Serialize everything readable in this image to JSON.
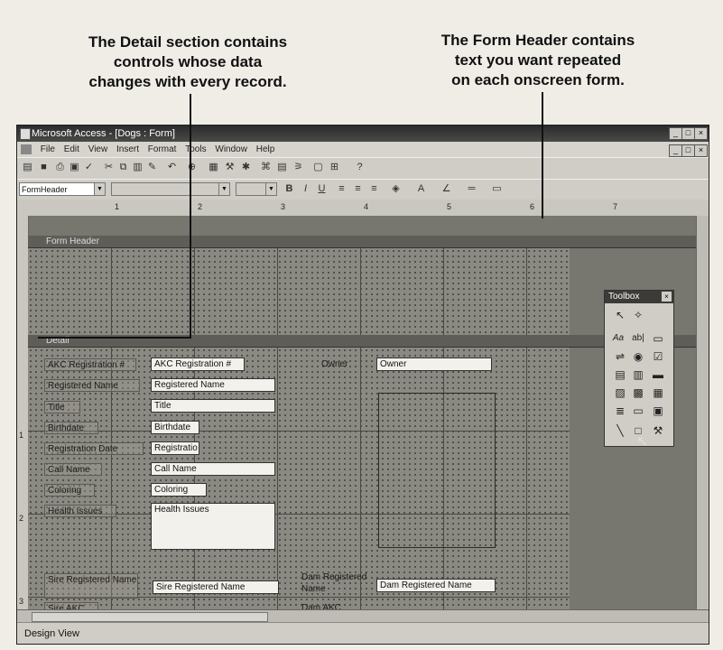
{
  "callouts": {
    "detail": [
      "The Detail section contains",
      "controls whose data",
      "changes with every record."
    ],
    "header": [
      "The Form Header contains",
      "text you want repeated",
      "on each onscreen form."
    ]
  },
  "window": {
    "title": "Microsoft Access - [Dogs : Form]",
    "controls": [
      "_",
      "□",
      "×"
    ]
  },
  "menu": [
    "File",
    "Edit",
    "View",
    "Insert",
    "Format",
    "Tools",
    "Window",
    "Help"
  ],
  "format_toolbar": {
    "object_combo": "FormHeader",
    "font_combo": "",
    "size_combo": "",
    "bold": "B",
    "italic": "I",
    "underline": "U"
  },
  "ruler": [
    "1",
    "2",
    "3",
    "4",
    "5",
    "6",
    "7"
  ],
  "vruler": [
    "1",
    "2",
    "3"
  ],
  "sections": {
    "form_header": "Form Header",
    "detail": "Detail"
  },
  "fields": [
    {
      "label": "AKC Registration #",
      "value": "AKC Registration #"
    },
    {
      "label": "Registered Name",
      "value": "Registered Name"
    },
    {
      "label": "Title",
      "value": "Title"
    },
    {
      "label": "Birthdate",
      "value": "Birthdate"
    },
    {
      "label": "Registration Date",
      "value": "Registratio"
    },
    {
      "label": "Call Name",
      "value": "Call Name"
    },
    {
      "label": "Coloring",
      "value": "Coloring"
    },
    {
      "label": "Health Issues",
      "value": "Health Issues"
    },
    {
      "label": "Sire Registered Name",
      "value": "Sire Registered Name"
    },
    {
      "label": "Sire AKC",
      "value": ""
    }
  ],
  "right_fields": [
    {
      "label": "Owner",
      "value": "Owner"
    },
    {
      "label": "Dam Registered Name",
      "value": "Dam Registered Name"
    },
    {
      "label": "Dam AKC",
      "value": ""
    }
  ],
  "toolbox": {
    "title": "Toolbox",
    "tools": [
      "select-objects",
      "control-wizards",
      "label",
      "text-box",
      "option-group",
      "toggle-button",
      "option-button",
      "check-box",
      "combo-box",
      "list-box",
      "command-button",
      "image",
      "unbound-object-frame",
      "bound-object-frame",
      "page-break",
      "tab-control",
      "subform",
      "line",
      "rectangle",
      "more-controls"
    ]
  },
  "status": "Design View"
}
